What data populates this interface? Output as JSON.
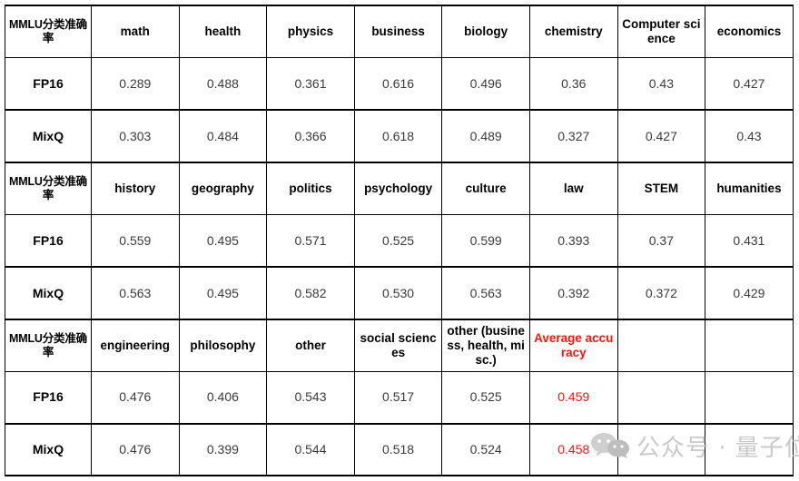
{
  "table": {
    "corner_label": "MMLU分类准确率",
    "row_labels": {
      "fp16": "FP16",
      "mixq": "MixQ"
    },
    "accent_color": "#f8130b",
    "sections": [
      {
        "headers": [
          "math",
          "health",
          "physics",
          "business",
          "biology",
          "chemistry",
          "Computer science",
          "economics"
        ],
        "fp16": [
          "0.289",
          "0.488",
          "0.361",
          "0.616",
          "0.496",
          "0.36",
          "0.43",
          "0.427"
        ],
        "mixq": [
          "0.303",
          "0.484",
          "0.366",
          "0.618",
          "0.489",
          "0.327",
          "0.427",
          "0.43"
        ],
        "highlight": [
          false,
          false,
          false,
          false,
          false,
          false,
          false,
          false
        ]
      },
      {
        "headers": [
          "history",
          "geography",
          "politics",
          "psychology",
          "culture",
          "law",
          "STEM",
          "humanities"
        ],
        "fp16": [
          "0.559",
          "0.495",
          "0.571",
          "0.525",
          "0.599",
          "0.393",
          "0.37",
          "0.431"
        ],
        "mixq": [
          "0.563",
          "0.495",
          "0.582",
          "0.530",
          "0.563",
          "0.392",
          "0.372",
          "0.429"
        ],
        "highlight": [
          false,
          false,
          false,
          false,
          false,
          false,
          false,
          false
        ]
      },
      {
        "headers": [
          "engineering",
          "philosophy",
          "other",
          "social sciences",
          "other (business, health, misc.)",
          "Average accuracy",
          "",
          ""
        ],
        "fp16": [
          "0.476",
          "0.406",
          "0.543",
          "0.517",
          "0.525",
          "0.459",
          "",
          ""
        ],
        "mixq": [
          "0.476",
          "0.399",
          "0.544",
          "0.518",
          "0.524",
          "0.458",
          "",
          ""
        ],
        "highlight": [
          false,
          false,
          false,
          false,
          false,
          true,
          false,
          false
        ]
      }
    ]
  },
  "watermark": {
    "text": "公众号 · 量子位",
    "logo_name": "wechat-logo",
    "color": "#c9c9c9"
  }
}
